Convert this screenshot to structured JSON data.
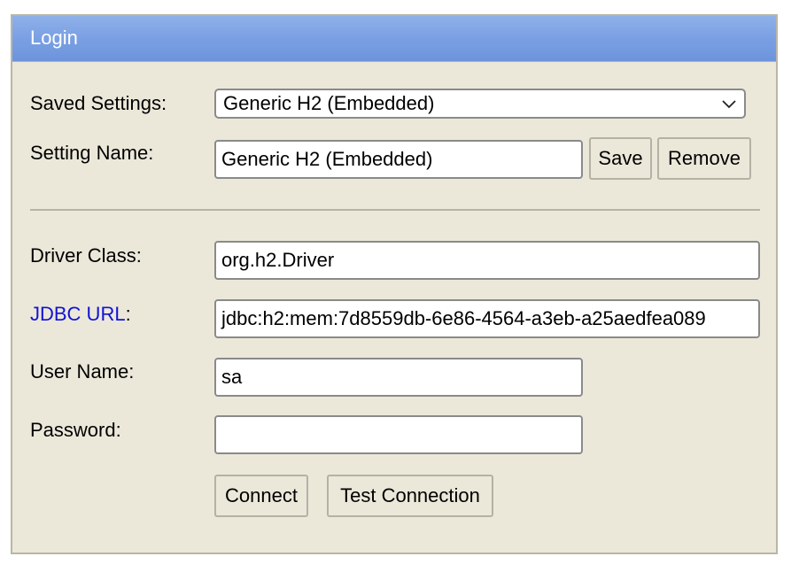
{
  "header": {
    "title": "Login"
  },
  "saved_settings": {
    "label": "Saved Settings:",
    "selected": "Generic H2 (Embedded)"
  },
  "setting_name": {
    "label": "Setting Name:",
    "value": "Generic H2 (Embedded)",
    "save_label": "Save",
    "remove_label": "Remove"
  },
  "driver_class": {
    "label": "Driver Class:",
    "value": "org.h2.Driver"
  },
  "jdbc_url": {
    "link_text": "JDBC URL",
    "suffix": ":",
    "value": "jdbc:h2:mem:7d8559db-6e86-4564-a3eb-a25aedfea089"
  },
  "user_name": {
    "label": "User Name:",
    "value": "sa"
  },
  "password": {
    "label": "Password:",
    "value": ""
  },
  "actions": {
    "connect_label": "Connect",
    "test_connection_label": "Test Connection"
  },
  "colors": {
    "header_gradient": "#7aa0e3",
    "panel_background": "#ebe8da",
    "link": "#1212d4"
  }
}
